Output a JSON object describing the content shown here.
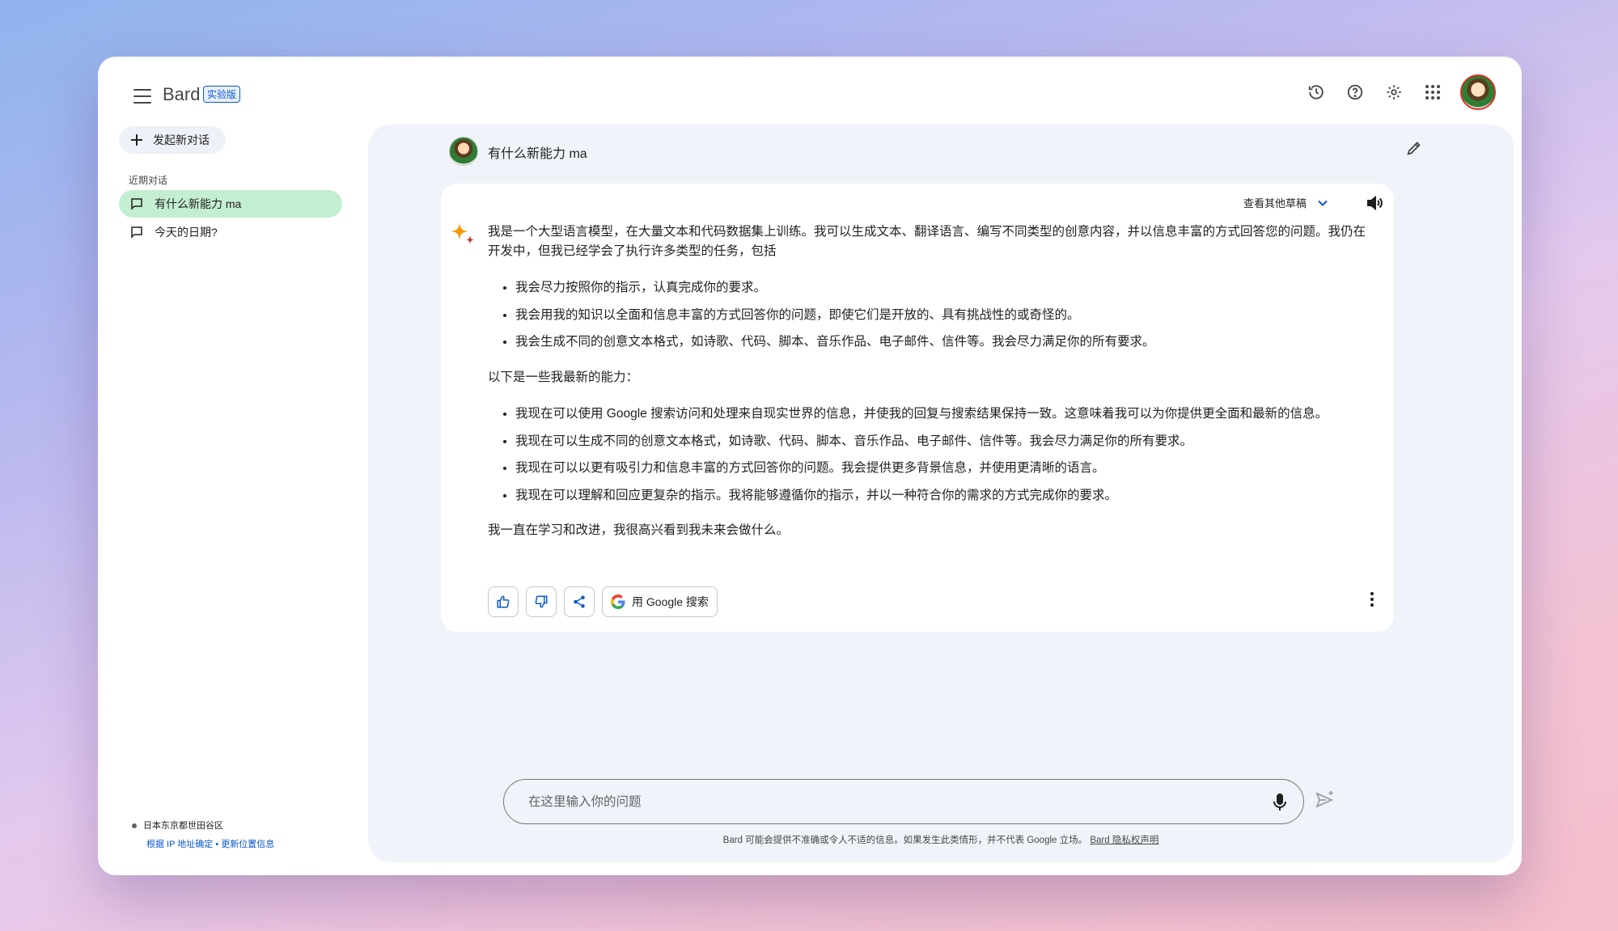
{
  "header": {
    "brand": "Bard",
    "badge": "实验版",
    "icons": [
      "menu-icon",
      "history-icon",
      "help-icon",
      "settings-icon",
      "apps-icon",
      "avatar"
    ]
  },
  "sidebar": {
    "new_chat": "发起新对话",
    "recent_label": "近期对话",
    "items": [
      {
        "label": "有什么新能力 ma",
        "active": true
      },
      {
        "label": "今天的日期?",
        "active": false
      }
    ],
    "location": "日本东京都世田谷区",
    "location_source": "根据 IP 地址确定",
    "location_separator": " • ",
    "location_update": "更新位置信息"
  },
  "conversation": {
    "question": "有什么新能力 ma",
    "drafts_label": "查看其他草稿",
    "intro": "我是一个大型语言模型，在大量文本和代码数据集上训练。我可以生成文本、翻译语言、编写不同类型的创意内容，并以信息丰富的方式回答您的问题。我仍在开发中，但我已经学会了执行许多类型的任务，包括",
    "list1": [
      "我会尽力按照你的指示，认真完成你的要求。",
      "我会用我的知识以全面和信息丰富的方式回答你的问题，即使它们是开放的、具有挑战性的或奇怪的。",
      "我会生成不同的创意文本格式，如诗歌、代码、脚本、音乐作品、电子邮件、信件等。我会尽力满足你的所有要求。"
    ],
    "middle": "以下是一些我最新的能力：",
    "list2": [
      "我现在可以使用 Google 搜索访问和处理来自现实世界的信息，并使我的回复与搜索结果保持一致。这意味着我可以为你提供更全面和最新的信息。",
      "我现在可以生成不同的创意文本格式，如诗歌、代码、脚本、音乐作品、电子邮件、信件等。我会尽力满足你的所有要求。",
      "我现在可以以更有吸引力和信息丰富的方式回答你的问题。我会提供更多背景信息，并使用更清晰的语言。",
      "我现在可以理解和回应更复杂的指示。我将能够遵循你的指示，并以一种符合你的需求的方式完成你的要求。"
    ],
    "closing": "我一直在学习和改进，我很高兴看到我未来会做什么。",
    "google_search_label": "用 Google 搜索"
  },
  "input": {
    "placeholder": "在这里输入你的问题"
  },
  "footer": {
    "disclaimer": "Bard 可能会提供不准确或令人不适的信息。如果发生此类情形，并不代表 Google 立场。",
    "privacy_link": "Bard 隐私权声明"
  },
  "colors": {
    "accent": "#0b57d0",
    "active_item": "#c4eed0",
    "panel": "#f0f4fa"
  }
}
